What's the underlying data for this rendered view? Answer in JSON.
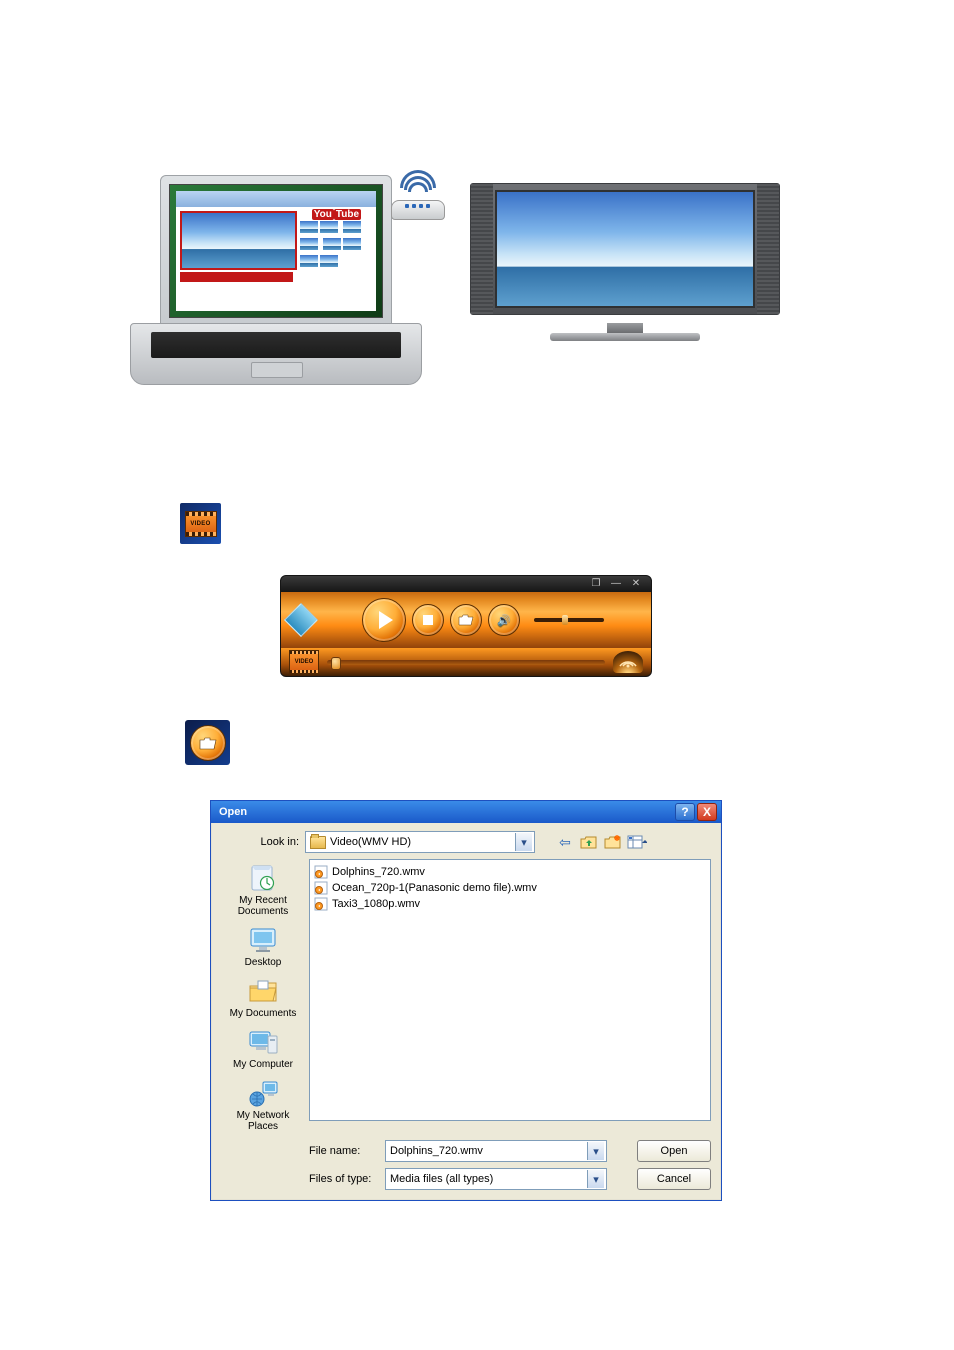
{
  "hero": {
    "browser_logo_left": "You",
    "browser_logo_right": "Tube"
  },
  "video_icon": {
    "label": "VIDEO"
  },
  "player": {
    "titlebar": {
      "restore": "❐",
      "minimize": "—",
      "close": "✕"
    },
    "mini_label": "VIDEO",
    "play_glyph": "play",
    "stop_glyph": "stop",
    "open_glyph": "open",
    "speaker_glyph": "🔊"
  },
  "open_button": {
    "glyph": "open"
  },
  "dialog": {
    "title": "Open",
    "help": "?",
    "close": "X",
    "look_in_label": "Look in:",
    "look_in_value": "Video(WMV HD)",
    "toolbar": {
      "back": "⇦",
      "up": "up",
      "new": "new",
      "views": "views"
    },
    "places": [
      "My Recent Documents",
      "Desktop",
      "My Documents",
      "My Computer",
      "My Network Places"
    ],
    "files": [
      "Dolphins_720.wmv",
      "Ocean_720p-1(Panasonic demo file).wmv",
      "Taxi3_1080p.wmv"
    ],
    "file_name_label": "File name:",
    "file_name_value": "Dolphins_720.wmv",
    "files_of_type_label": "Files of type:",
    "files_of_type_value": "Media files (all types)",
    "open_btn": "Open",
    "cancel_btn": "Cancel"
  }
}
